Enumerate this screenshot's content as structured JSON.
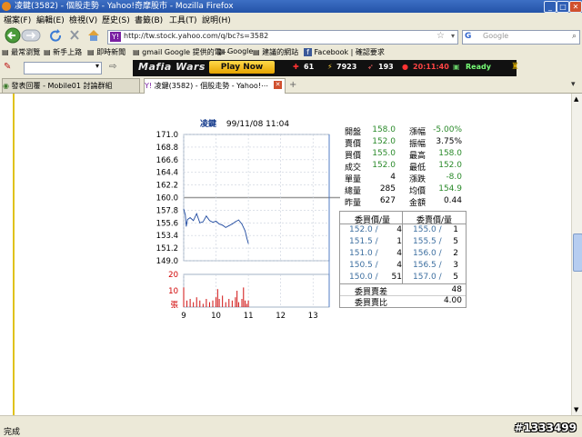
{
  "window": {
    "title": "凌鍵(3582) - 個股走勢 - Yahoo!奇摩股市 - Mozilla Firefox"
  },
  "menu": [
    "檔案(F)",
    "編輯(E)",
    "檢視(V)",
    "歷史(S)",
    "書籤(B)",
    "工具(T)",
    "說明(H)"
  ],
  "address": {
    "url": "http://tw.stock.yahoo.com/q/bc?s=3582"
  },
  "search": {
    "engine": "G",
    "placeholder": "Google"
  },
  "bookmarks": [
    "最常瀏覽",
    "新手上路",
    "即時新聞",
    "gmail Google 提供的電⋯",
    "Google",
    "建議的網站",
    "Facebook | 確認要求"
  ],
  "mafia": {
    "logo": "Mafia Wars",
    "play": "Play Now",
    "health": "61",
    "energy": "7923",
    "stamina": "193",
    "timer": "20:11:40",
    "status": "Ready"
  },
  "tabs": [
    {
      "label": "發表回覆 - Mobile01 討論群組"
    },
    {
      "label": "凌鍵(3582) - 個股走勢 - Yahoo!⋯"
    }
  ],
  "stock": {
    "name": "凌鍵",
    "datetime": "99/11/08 11:04",
    "quote": [
      {
        "l1": "開盤",
        "v1": "158.0",
        "c1": "green",
        "l2": "漲幅",
        "v2": "-5.00%",
        "c2": "green"
      },
      {
        "l1": "賣價",
        "v1": "152.0",
        "c1": "green",
        "l2": "振幅",
        "v2": "3.75%",
        "c2": "black"
      },
      {
        "l1": "買價",
        "v1": "155.0",
        "c1": "green",
        "l2": "最高",
        "v2": "158.0",
        "c2": "green"
      },
      {
        "l1": "成交",
        "v1": "152.0",
        "c1": "green",
        "l2": "最低",
        "v2": "152.0",
        "c2": "green"
      },
      {
        "l1": "單量",
        "v1": "4",
        "c1": "black",
        "l2": "漲跌",
        "v2": "-8.0",
        "c2": "green"
      },
      {
        "l1": "總量",
        "v1": "285",
        "c1": "black",
        "l2": "均價",
        "v2": "154.9",
        "c2": "green"
      },
      {
        "l1": "昨量",
        "v1": "627",
        "c1": "black",
        "l2": "金額",
        "v2": "0.44",
        "c2": "black"
      }
    ],
    "orders_header": {
      "buy": "委買價/量",
      "sell": "委賣價/量"
    },
    "orders": [
      {
        "bp": "152.0 /",
        "bv": "4",
        "sp": "155.0 /",
        "sv": "1"
      },
      {
        "bp": "151.5 /",
        "bv": "1",
        "sp": "155.5 /",
        "sv": "5"
      },
      {
        "bp": "151.0 /",
        "bv": "4",
        "sp": "156.0 /",
        "sv": "2"
      },
      {
        "bp": "150.5 /",
        "bv": "4",
        "sp": "156.5 /",
        "sv": "3"
      },
      {
        "bp": "150.0 /",
        "bv": "51",
        "sp": "157.0 /",
        "sv": "5"
      }
    ],
    "diff_label": "委買賣差",
    "diff_value": "48",
    "ratio_label": "委買賣比",
    "ratio_value": "4.00"
  },
  "status": {
    "text": "完成",
    "id": "#1333499"
  },
  "chart_data": {
    "type": "line",
    "y_ticks": [
      "171.0",
      "168.8",
      "166.6",
      "164.4",
      "162.2",
      "160.0",
      "157.8",
      "155.6",
      "153.4",
      "151.2",
      "149.0"
    ],
    "ylim": [
      149.0,
      171.0
    ],
    "reference": 160.0,
    "x_ticks": [
      "9",
      "10",
      "11",
      "12",
      "13"
    ],
    "xlim": [
      9,
      13.5
    ],
    "price_series": [
      [
        9.0,
        158.0
      ],
      [
        9.05,
        157.0
      ],
      [
        9.08,
        155.0
      ],
      [
        9.12,
        156.2
      ],
      [
        9.2,
        156.5
      ],
      [
        9.3,
        156.0
      ],
      [
        9.4,
        157.2
      ],
      [
        9.5,
        155.6
      ],
      [
        9.6,
        155.8
      ],
      [
        9.7,
        156.8
      ],
      [
        9.8,
        156.0
      ],
      [
        9.9,
        155.7
      ],
      [
        10.0,
        155.9
      ],
      [
        10.1,
        155.4
      ],
      [
        10.2,
        155.2
      ],
      [
        10.3,
        154.8
      ],
      [
        10.4,
        155.1
      ],
      [
        10.5,
        155.4
      ],
      [
        10.6,
        155.8
      ],
      [
        10.7,
        156.1
      ],
      [
        10.8,
        155.4
      ],
      [
        10.9,
        154.2
      ],
      [
        10.95,
        153.0
      ],
      [
        11.0,
        152.0
      ]
    ],
    "volume_ticks": [
      "20",
      "10",
      "張"
    ],
    "volume_max": 20,
    "volume": [
      [
        9.0,
        12
      ],
      [
        9.1,
        4
      ],
      [
        9.2,
        5
      ],
      [
        9.3,
        3
      ],
      [
        9.4,
        6
      ],
      [
        9.5,
        4
      ],
      [
        9.6,
        2
      ],
      [
        9.7,
        5
      ],
      [
        9.8,
        3
      ],
      [
        9.9,
        4
      ],
      [
        10.0,
        6
      ],
      [
        10.05,
        11
      ],
      [
        10.1,
        5
      ],
      [
        10.2,
        7
      ],
      [
        10.3,
        3
      ],
      [
        10.4,
        5
      ],
      [
        10.5,
        4
      ],
      [
        10.6,
        6
      ],
      [
        10.65,
        10
      ],
      [
        10.7,
        3
      ],
      [
        10.8,
        5
      ],
      [
        10.85,
        12
      ],
      [
        10.9,
        4
      ],
      [
        10.95,
        2
      ],
      [
        11.0,
        4
      ]
    ]
  }
}
